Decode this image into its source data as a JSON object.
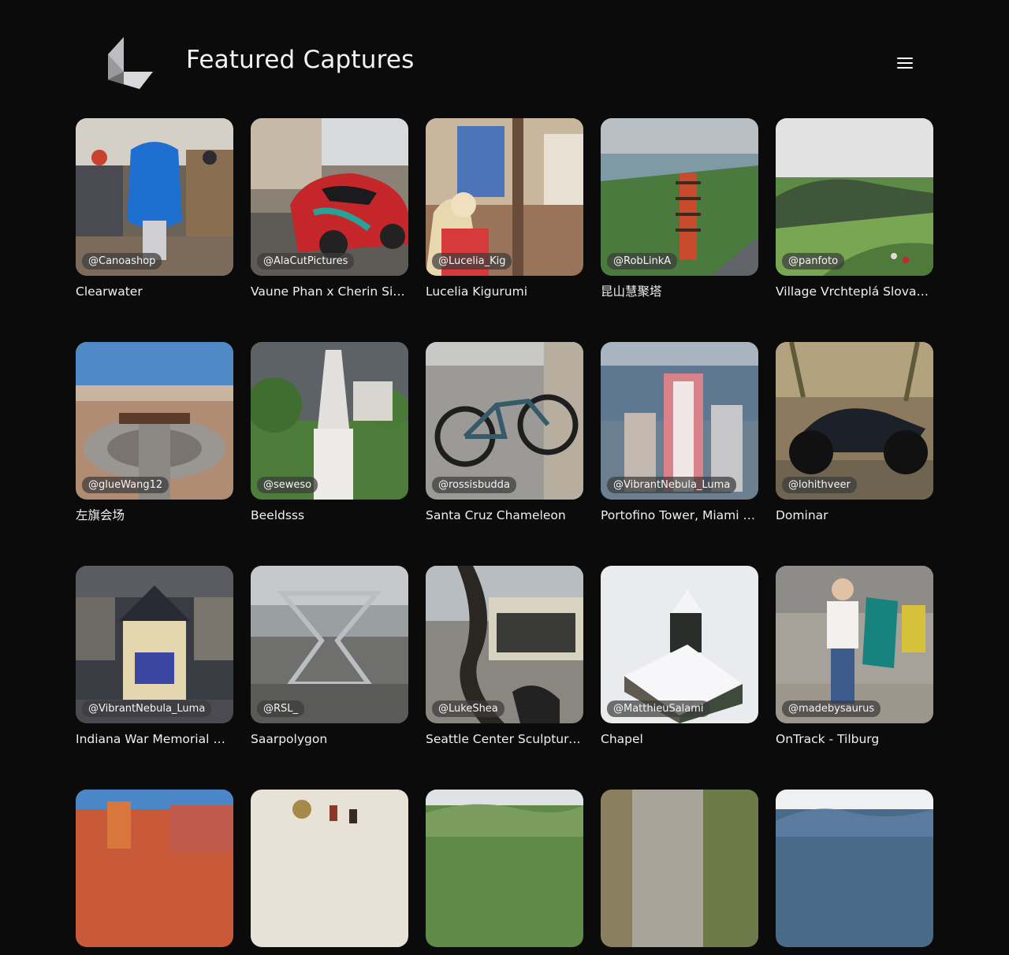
{
  "header": {
    "title": "Featured Captures",
    "logo_icon": "cube-corner-logo-icon",
    "menu_icon": "hamburger-menu-icon"
  },
  "captures": [
    {
      "handle": "@Canoashop",
      "title": "Clearwater"
    },
    {
      "handle": "@AlaCutPictures",
      "title": "Vaune Phan x Cherin Simone"
    },
    {
      "handle": "@Lucelia_Kig",
      "title": "Lucelia Kigurumi"
    },
    {
      "handle": "@RobLinkA",
      "title": "昆山慧聚塔"
    },
    {
      "handle": "@panfoto",
      "title": "Village Vrchteplá Slovakia"
    },
    {
      "handle": "@glueWang12",
      "title": "左旗会场"
    },
    {
      "handle": "@seweso",
      "title": "Beeldsss"
    },
    {
      "handle": "@rossisbudda",
      "title": "Santa Cruz Chameleon"
    },
    {
      "handle": "@VibrantNebula_Luma",
      "title": "Portofino Tower, Miami Beach"
    },
    {
      "handle": "@lohithveer",
      "title": "Dominar"
    },
    {
      "handle": "@VibrantNebula_Luma",
      "title": "Indiana War Memorial & Museum"
    },
    {
      "handle": "@RSL_",
      "title": "Saarpolygon"
    },
    {
      "handle": "@LukeShea",
      "title": "Seattle Center Sculpture Garden"
    },
    {
      "handle": "@MatthieuSalami",
      "title": "Chapel"
    },
    {
      "handle": "@madebysaurus",
      "title": "OnTrack - Tilburg"
    },
    {
      "handle": "",
      "title": ""
    },
    {
      "handle": "",
      "title": ""
    },
    {
      "handle": "",
      "title": ""
    },
    {
      "handle": "",
      "title": ""
    },
    {
      "handle": "",
      "title": ""
    }
  ]
}
